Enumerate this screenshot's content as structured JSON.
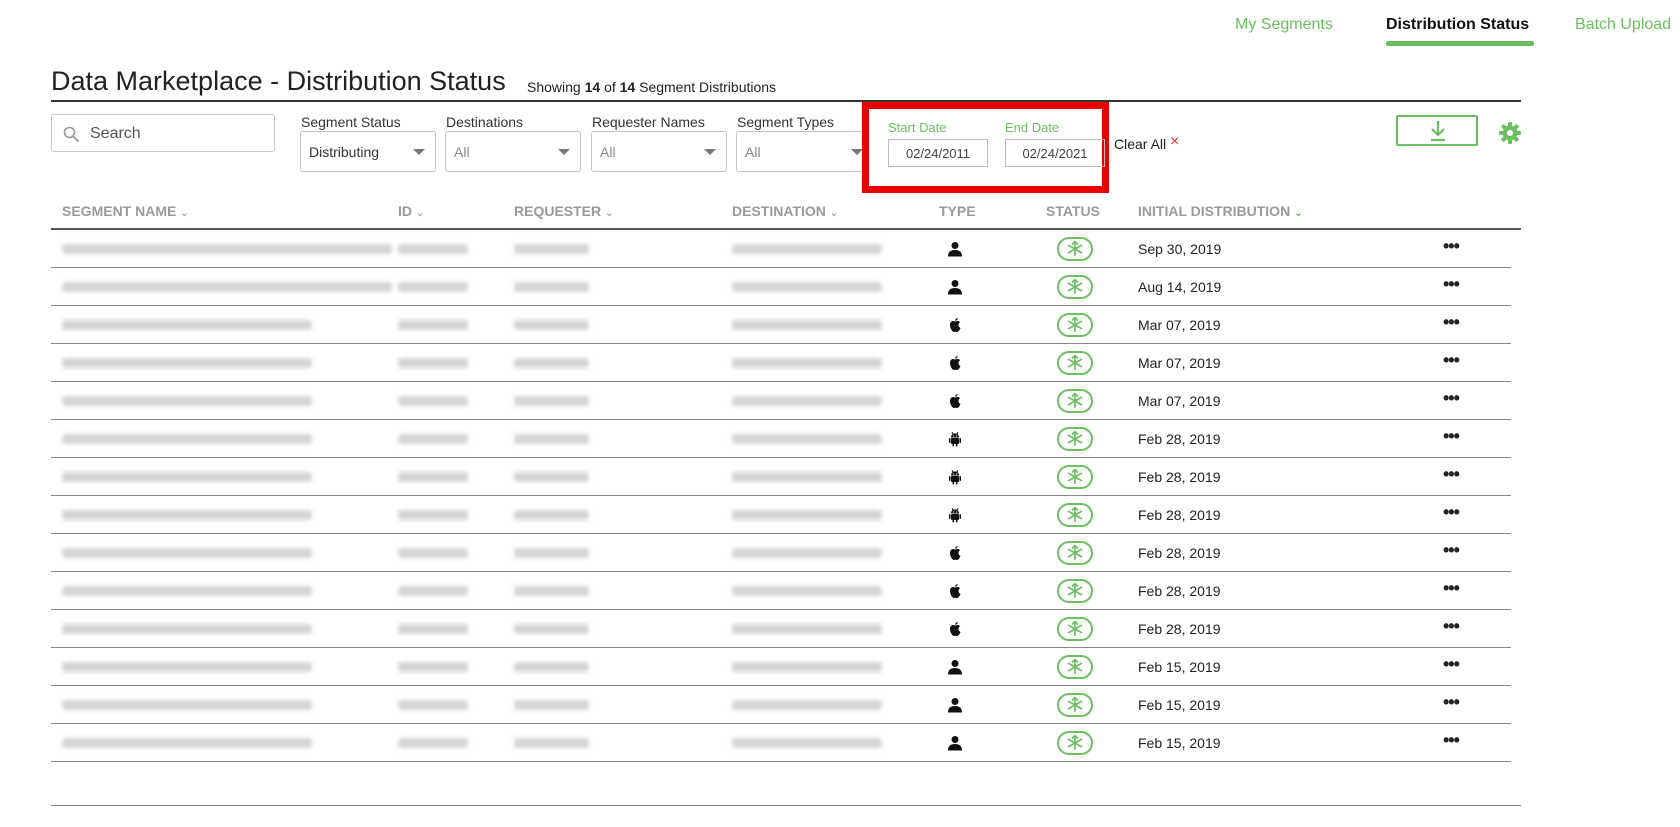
{
  "nav": {
    "my_segments": "My Segments",
    "distribution_status": "Distribution Status",
    "batch_upload": "Batch Upload"
  },
  "header": {
    "title": "Data Marketplace - Distribution Status",
    "count_prefix": "Showing",
    "shown": "14",
    "of": "of",
    "total": "14",
    "count_suffix": "Segment Distributions"
  },
  "search": {
    "placeholder": "Search",
    "icon": "search-icon"
  },
  "filters": {
    "segment_status": {
      "label": "Segment Status",
      "value": "Distributing"
    },
    "destinations": {
      "label": "Destinations",
      "value": "All"
    },
    "requester_names": {
      "label": "Requester Names",
      "value": "All"
    },
    "segment_types": {
      "label": "Segment Types",
      "value": "All"
    },
    "start_date": {
      "label": "Start Date",
      "value": "02/24/2011"
    },
    "end_date": {
      "label": "End Date",
      "value": "02/24/2021"
    },
    "clear_all": "Clear All",
    "clear_icon": "×"
  },
  "actions": {
    "download_icon": "download-icon",
    "settings_icon": "gear-icon"
  },
  "colors": {
    "accent": "#6abf5e",
    "highlight": "#e80000",
    "clear": "#e33333"
  },
  "table": {
    "columns": {
      "segment_name": "SEGMENT NAME",
      "id": "ID",
      "requester": "REQUESTER",
      "destination": "DESTINATION",
      "type": "TYPE",
      "status": "STATUS",
      "initial_distribution": "INITIAL DISTRIBUTION"
    },
    "rows": [
      {
        "type": "person",
        "status": "distributing",
        "date": "Sep 30, 2019"
      },
      {
        "type": "person",
        "status": "distributing",
        "date": "Aug 14, 2019"
      },
      {
        "type": "apple",
        "status": "distributing",
        "date": "Mar 07, 2019"
      },
      {
        "type": "apple",
        "status": "distributing",
        "date": "Mar 07, 2019"
      },
      {
        "type": "apple",
        "status": "distributing",
        "date": "Mar 07, 2019"
      },
      {
        "type": "android",
        "status": "distributing",
        "date": "Feb 28, 2019"
      },
      {
        "type": "android",
        "status": "distributing",
        "date": "Feb 28, 2019"
      },
      {
        "type": "android",
        "status": "distributing",
        "date": "Feb 28, 2019"
      },
      {
        "type": "apple",
        "status": "distributing",
        "date": "Feb 28, 2019"
      },
      {
        "type": "apple",
        "status": "distributing",
        "date": "Feb 28, 2019"
      },
      {
        "type": "apple",
        "status": "distributing",
        "date": "Feb 28, 2019"
      },
      {
        "type": "person",
        "status": "distributing",
        "date": "Feb 15, 2019"
      },
      {
        "type": "person",
        "status": "distributing",
        "date": "Feb 15, 2019"
      },
      {
        "type": "person",
        "status": "distributing",
        "date": "Feb 15, 2019"
      }
    ],
    "more_label": "•••"
  }
}
